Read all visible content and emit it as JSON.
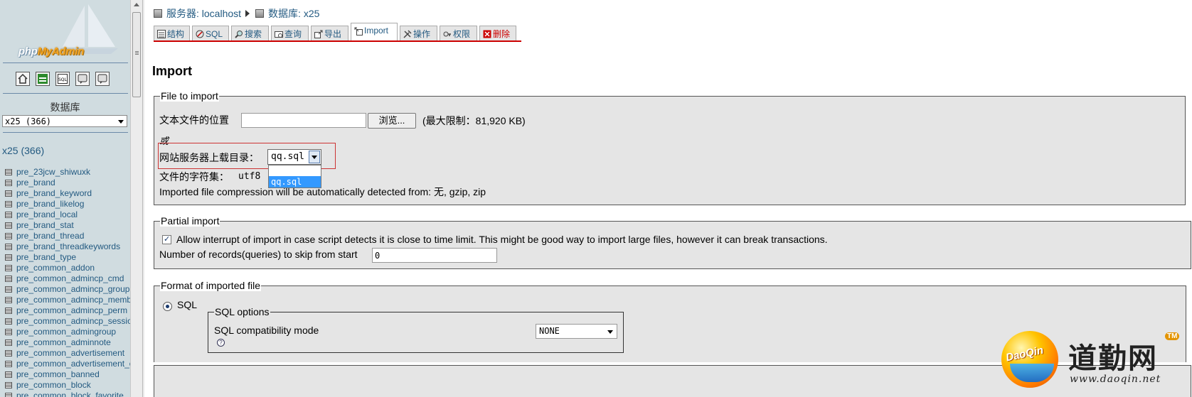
{
  "left_frame": {
    "logo_text_1": "php",
    "logo_text_2": "MyAdmin",
    "quick_icons": [
      "home-icon",
      "query-window-icon",
      "sql-icon",
      "docs-icon",
      "help-icon"
    ],
    "db_heading": "数据库",
    "db_select_value": "x25 (366)",
    "db_name_link": "x25 (366)",
    "tables": [
      "pre_23jcw_shiwuxk",
      "pre_brand",
      "pre_brand_keyword",
      "pre_brand_likelog",
      "pre_brand_local",
      "pre_brand_stat",
      "pre_brand_thread",
      "pre_brand_threadkeywords",
      "pre_brand_type",
      "pre_common_addon",
      "pre_common_admincp_cmd",
      "pre_common_admincp_group",
      "pre_common_admincp_member",
      "pre_common_admincp_perm",
      "pre_common_admincp_session",
      "pre_common_admingroup",
      "pre_common_adminnote",
      "pre_common_advertisement",
      "pre_common_advertisement_custom",
      "pre_common_banned",
      "pre_common_block",
      "pre_common_block_favorite"
    ]
  },
  "breadcrumb": {
    "server": "服务器: localhost",
    "database": "数据库: x25"
  },
  "tabs": [
    {
      "label": "结构",
      "icon": "structure-icon"
    },
    {
      "label": "SQL",
      "icon": "sql-icon"
    },
    {
      "label": "搜索",
      "icon": "search-icon"
    },
    {
      "label": "查询",
      "icon": "query-icon"
    },
    {
      "label": "导出",
      "icon": "export-icon"
    },
    {
      "label": "Import",
      "icon": "import-icon",
      "active": true
    },
    {
      "label": "操作",
      "icon": "operations-icon"
    },
    {
      "label": "权限",
      "icon": "privileges-icon"
    },
    {
      "label": "删除",
      "icon": "drop-icon"
    }
  ],
  "page_title": "Import",
  "file_to_import": {
    "legend": "File to import",
    "location_label": "文本文件的位置",
    "location_value": "",
    "browse_button": "浏览...",
    "max_limit": "(最大限制：81,920 KB)",
    "or_label": "或",
    "upload_dir_label": "网站服务器上载目录：",
    "upload_dir_value": "qq.sql",
    "upload_dir_options": [
      "",
      "qq.sql"
    ],
    "charset_label": "文件的字符集：",
    "charset_value": "utf8",
    "compression_note": "Imported file compression will be automatically detected from: 无, gzip, zip"
  },
  "partial_import": {
    "legend": "Partial import",
    "allow_interrupt_label": "Allow interrupt of import in case script detects it is close to time limit. This might be good way to import large files, however it can break transactions.",
    "allow_interrupt_checked": true,
    "skip_label": "Number of records(queries) to skip from start",
    "skip_value": "0"
  },
  "format": {
    "legend": "Format of imported file",
    "sql_radio_label": "SQL",
    "sql_options_legend": "SQL options",
    "compat_label": "SQL compatibility mode",
    "compat_value": "NONE",
    "help_glyph": "?"
  },
  "watermark": {
    "ball_text": "DaoQin",
    "chinese_name": "道勤网",
    "tm": "TM",
    "url": "www.daoqin.net"
  },
  "colors": {
    "link": "#235a81",
    "left_bg": "#d0dce0",
    "fieldset_bg": "#e5e5e5",
    "tab_underline": "#cc0000",
    "highlight": "#3399ff"
  }
}
